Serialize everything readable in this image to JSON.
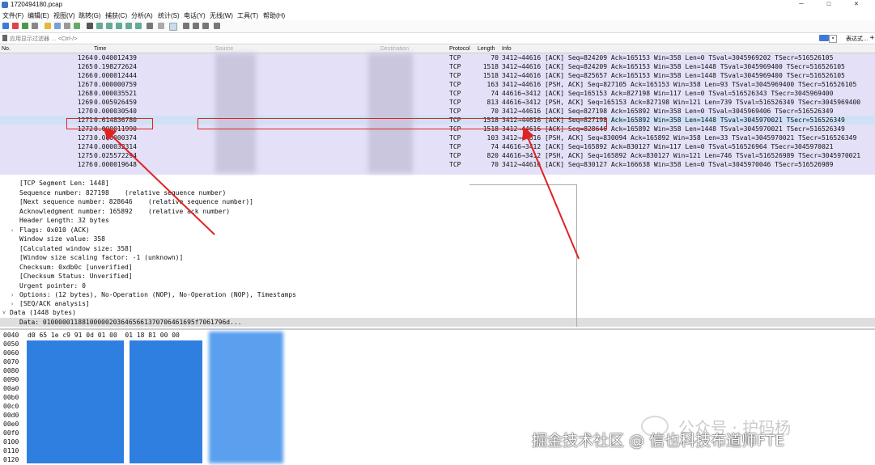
{
  "window": {
    "title": "1720494180.pcap"
  },
  "menu": [
    "文件(F)",
    "编辑(E)",
    "视图(V)",
    "跳转(G)",
    "捕获(C)",
    "分析(A)",
    "统计(S)",
    "电话(Y)",
    "无线(W)",
    "工具(T)",
    "帮助(H)"
  ],
  "filter": {
    "placeholder": "应用显示过滤器 … <Ctrl-/>",
    "expression_label": "表达式…",
    "plus": "+"
  },
  "packet_list": {
    "headers": {
      "no": "No.",
      "time": "Time",
      "source": "Source",
      "destination": "Destination",
      "protocol": "Protocol",
      "length": "Length",
      "info": "Info"
    },
    "rows": [
      {
        "no": "1264",
        "time": "0.040012439",
        "proto": "TCP",
        "len": "70",
        "info": "3412→44616 [ACK] Seq=824209 Ack=165153 Win=358 Len=0 TSval=3045969202 TSecr=516526105",
        "selected": false
      },
      {
        "no": "1265",
        "time": "0.198272624",
        "proto": "TCP",
        "len": "1518",
        "info": "3412→44616 [ACK] Seq=824209 Ack=165153 Win=358 Len=1448 TSval=3045969400 TSecr=516526105",
        "selected": false
      },
      {
        "no": "1266",
        "time": "0.000012444",
        "proto": "TCP",
        "len": "1518",
        "info": "3412→44616 [ACK] Seq=825657 Ack=165153 Win=358 Len=1448 TSval=3045969400 TSecr=516526105",
        "selected": false
      },
      {
        "no": "1267",
        "time": "0.000000759",
        "proto": "TCP",
        "len": "163",
        "info": "3412→44616 [PSH, ACK] Seq=827105 Ack=165153 Win=358 Len=93 TSval=3045969400 TSecr=516526105",
        "selected": false
      },
      {
        "no": "1268",
        "time": "0.000035521",
        "proto": "TCP",
        "len": "74",
        "info": "44616→3412 [ACK] Seq=165153 Ack=827198 Win=117 Len=0 TSval=516526343 TSecr=3045969400",
        "selected": false
      },
      {
        "no": "1269",
        "time": "0.005926459",
        "proto": "TCP",
        "len": "813",
        "info": "44616→3412 [PSH, ACK] Seq=165153 Ack=827198 Win=121 Len=739 TSval=516526349 TSecr=3045969400",
        "selected": false
      },
      {
        "no": "1270",
        "time": "0.000030540",
        "proto": "TCP",
        "len": "70",
        "info": "3412→44616 [ACK] Seq=827198 Ack=165892 Win=358 Len=0 TSval=3045969406 TSecr=516526349",
        "selected": false
      },
      {
        "no": "1271",
        "time": "0.614836780",
        "proto": "TCP",
        "len": "1518",
        "info": "3412→44616 [ACK] Seq=827198 Ack=165892 Win=358 Len=1448 TSval=3045970021 TSecr=516526349",
        "selected": true
      },
      {
        "no": "1272",
        "time": "0.000011990",
        "proto": "TCP",
        "len": "1518",
        "info": "3412→44616 [ACK] Seq=828646 Ack=165892 Win=358 Len=1448 TSval=3045970021 TSecr=516526349",
        "selected": false
      },
      {
        "no": "1273",
        "time": "0.000000374",
        "proto": "TCP",
        "len": "103",
        "info": "3412→44616 [PSH, ACK] Seq=830094 Ack=165892 Win=358 Len=33 TSval=3045970021 TSecr=516526349",
        "selected": false
      },
      {
        "no": "1274",
        "time": "0.000032314",
        "proto": "TCP",
        "len": "74",
        "info": "44616→3412 [ACK] Seq=165892 Ack=830127 Win=117 Len=0 TSval=516526964 TSecr=3045970021",
        "selected": false
      },
      {
        "no": "1275",
        "time": "0.025572294",
        "proto": "TCP",
        "len": "820",
        "info": "44616→3412 [PSH, ACK] Seq=165892 Ack=830127 Win=121 Len=746 TSval=516526989 TSecr=3045970021",
        "selected": false
      },
      {
        "no": "1276",
        "time": "0.000019648",
        "proto": "TCP",
        "len": "70",
        "info": "3412→44616 [ACK] Seq=830127 Ack=166638 Win=358 Len=0 TSval=3045970046 TSecr=516526989",
        "selected": false
      }
    ]
  },
  "details": {
    "lines": [
      "[TCP Segment Len: 1448]",
      "Sequence number: 827198    (relative sequence number)",
      "[Next sequence number: 828646    (relative sequence number)]",
      "Acknowledgment number: 165892    (relative ack number)",
      "Header Length: 32 bytes",
      "Flags: 0x010 (ACK)",
      "Window size value: 358",
      "[Calculated window size: 358]",
      "[Window size scaling factor: -1 (unknown)]",
      "Checksum: 0xdb0c [unverified]",
      "[Checksum Status: Unverified]",
      "Urgent pointer: 0",
      "Options: (12 bytes), No-Operation (NOP), No-Operation (NOP), Timestamps",
      "[SEQ/ACK analysis]"
    ],
    "data_header": "Data (1448 bytes)",
    "data_value": "Data: 010000011881000002036465661370706461695f7061796d..."
  },
  "hex": {
    "offsets": [
      "0040",
      "0050",
      "0060",
      "0070",
      "0080",
      "0090",
      "00a0",
      "00b0",
      "00c0",
      "00d0",
      "00e0",
      "00f0",
      "0100",
      "0110",
      "0120"
    ],
    "first_row": "d0 65 1e c9 91 0d 01 00  01 18 81 00 00"
  },
  "watermark": {
    "line1": "公众号 · 护码杨",
    "line2": "掘金技术社区 @ 信也科技布道师FTE"
  }
}
